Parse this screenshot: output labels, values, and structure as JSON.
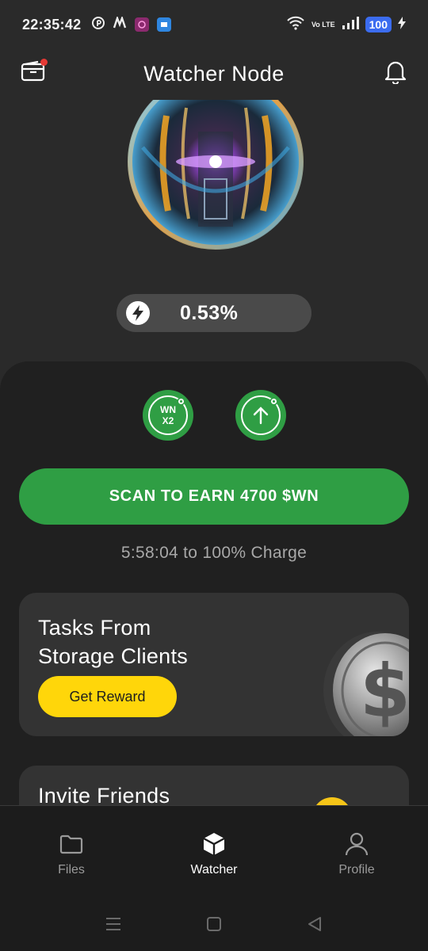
{
  "status_bar": {
    "time": "22:35:42",
    "apps": [
      "pinterest-icon",
      "m-logo-icon",
      "purple-app-icon",
      "blue-app-icon"
    ],
    "network_label": "Vo LTE",
    "battery": "100"
  },
  "header": {
    "title": "Watcher Node"
  },
  "charge": {
    "percent": "0.53%"
  },
  "boosts": {
    "multiplier_line1": "WN",
    "multiplier_line2": "X2"
  },
  "scan_button": {
    "label": "SCAN TO EARN 4700 $WN"
  },
  "charge_eta": "5:58:04 to 100% Charge",
  "tasks_card": {
    "title_line1": "Tasks From",
    "title_line2": "Storage Clients",
    "button_label": "Get Reward"
  },
  "invite_card": {
    "title": "Invite Friends"
  },
  "bottom_nav": {
    "items": [
      {
        "label": "Files",
        "icon": "folder-icon"
      },
      {
        "label": "Watcher",
        "icon": "cube-icon",
        "active": true
      },
      {
        "label": "Profile",
        "icon": "user-icon"
      }
    ]
  },
  "colors": {
    "accent_green": "#2f9e44",
    "reward_yellow": "#ffd60a",
    "background": "#2a2a2a",
    "panel": "#202020"
  }
}
